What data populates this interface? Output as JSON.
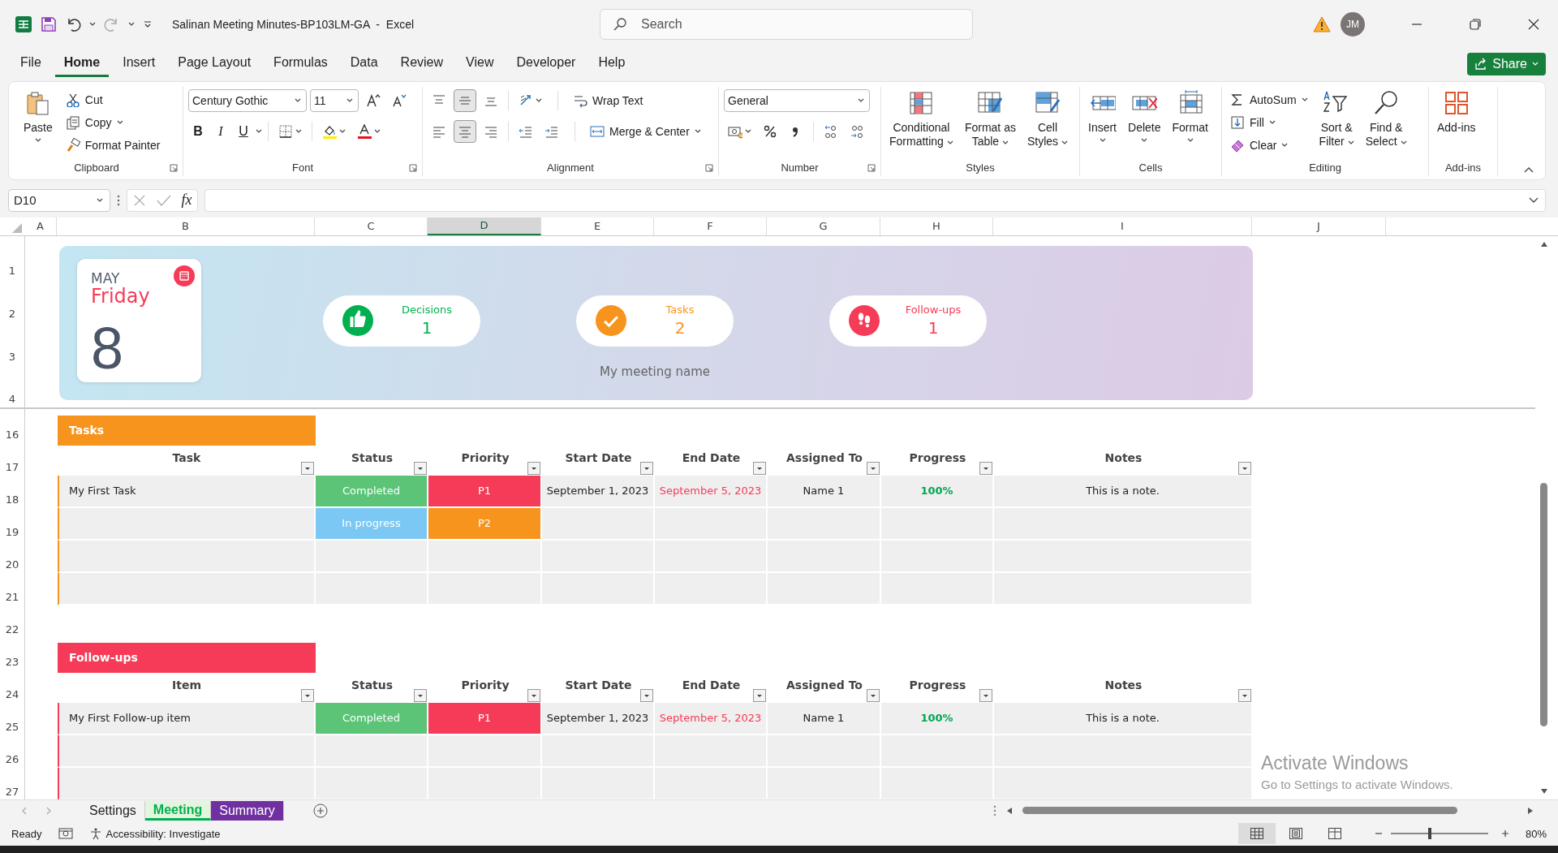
{
  "title_bar": {
    "document_title": "Salinan Meeting Minutes-BP103LM-GA  -  Excel",
    "search_placeholder": "Search",
    "user_initials": "JM"
  },
  "menu_tabs": [
    {
      "label": "File",
      "selected": false
    },
    {
      "label": "Home",
      "selected": true
    },
    {
      "label": "Insert",
      "selected": false
    },
    {
      "label": "Page Layout",
      "selected": false
    },
    {
      "label": "Formulas",
      "selected": false
    },
    {
      "label": "Data",
      "selected": false
    },
    {
      "label": "Review",
      "selected": false
    },
    {
      "label": "View",
      "selected": false
    },
    {
      "label": "Developer",
      "selected": false
    },
    {
      "label": "Help",
      "selected": false
    }
  ],
  "share_button": "Share",
  "ribbon": {
    "clipboard": {
      "label": "Clipboard",
      "paste": "Paste",
      "cut": "Cut",
      "copy": "Copy",
      "format_painter": "Format Painter"
    },
    "font": {
      "label": "Font",
      "font_name": "Century Gothic",
      "font_size": "11",
      "bold": "B",
      "italic": "I",
      "underline": "U"
    },
    "alignment": {
      "label": "Alignment",
      "wrap_text": "Wrap Text",
      "merge_center": "Merge & Center"
    },
    "number": {
      "label": "Number",
      "format": "General"
    },
    "styles": {
      "label": "Styles",
      "buttons": [
        {
          "kind": "conditional",
          "lines": [
            "Conditional",
            "Formatting"
          ]
        },
        {
          "kind": "table",
          "lines": [
            "Format as",
            "Table"
          ]
        },
        {
          "kind": "cellstyles",
          "lines": [
            "Cell",
            "Styles"
          ]
        }
      ]
    },
    "cells": {
      "label": "Cells",
      "buttons": [
        {
          "kind": "insert",
          "lines": [
            "Insert"
          ]
        },
        {
          "kind": "delete",
          "lines": [
            "Delete"
          ]
        },
        {
          "kind": "format",
          "lines": [
            "Format"
          ]
        }
      ]
    },
    "editing": {
      "label": "Editing",
      "autosum": "AutoSum",
      "fill": "Fill",
      "clear": "Clear",
      "buttons": [
        {
          "kind": "sort",
          "lines": [
            "Sort &",
            "Filter"
          ]
        },
        {
          "kind": "find",
          "lines": [
            "Find &",
            "Select"
          ]
        }
      ]
    },
    "addins": {
      "label": "Add-ins",
      "buttons": [
        {
          "kind": "addins",
          "lines": [
            "Add-ins"
          ]
        }
      ]
    }
  },
  "formula_bar": {
    "name_box": "D10",
    "function_button": "fx"
  },
  "column_headers": [
    {
      "label": "A",
      "selected": false
    },
    {
      "label": "B",
      "selected": false
    },
    {
      "label": "C",
      "selected": false
    },
    {
      "label": "D",
      "selected": true
    },
    {
      "label": "E",
      "selected": false
    },
    {
      "label": "F",
      "selected": false
    },
    {
      "label": "G",
      "selected": false
    },
    {
      "label": "H",
      "selected": false
    },
    {
      "label": "I",
      "selected": false
    },
    {
      "label": "J",
      "selected": false
    }
  ],
  "row_headers": [
    "1",
    "2",
    "3",
    "4",
    "16",
    "17",
    "18",
    "19",
    "20",
    "21",
    "22",
    "23",
    "24",
    "25",
    "26",
    "27"
  ],
  "dashboard": {
    "month": "MAY",
    "weekday": "Friday",
    "day": "8",
    "meeting_name": "My meeting name",
    "stats": [
      {
        "kind": "decisions",
        "label": "Decisions",
        "value": "1",
        "color": "#00b050"
      },
      {
        "kind": "tasks",
        "label": "Tasks",
        "value": "2",
        "color": "#f7941d"
      },
      {
        "kind": "followups",
        "label": "Follow-ups",
        "value": "1",
        "color": "#f53b57"
      }
    ]
  },
  "tables": [
    {
      "title": "Tasks",
      "color": "#f7941d",
      "columns": [
        "Task",
        "Status",
        "Priority",
        "Start Date",
        "End Date",
        "Assigned To",
        "Progress",
        "Notes"
      ],
      "rows": [
        {
          "item": "My First Task",
          "status": {
            "text": "Completed",
            "color": "#5bc477"
          },
          "priority": {
            "text": "P1",
            "color": "#f53b57"
          },
          "start_date": "September 1, 2023",
          "end_date": "September 5, 2023",
          "assigned_to": "Name 1",
          "progress": "100%",
          "notes": "This is a note."
        },
        {
          "status": {
            "text": "In progress",
            "color": "#7cc8f5"
          },
          "priority": {
            "text": "P2",
            "color": "#f7941d"
          }
        }
      ]
    },
    {
      "title": "Follow-ups",
      "color": "#f53b57",
      "columns": [
        "Item",
        "Status",
        "Priority",
        "Start Date",
        "End Date",
        "Assigned To",
        "Progress",
        "Notes"
      ],
      "rows": [
        {
          "item": "My First Follow-up item",
          "status": {
            "text": "Completed",
            "color": "#5bc477"
          },
          "priority": {
            "text": "P1",
            "color": "#f53b57"
          },
          "start_date": "September 1, 2023",
          "end_date": "September 5, 2023",
          "assigned_to": "Name 1",
          "progress": "100%",
          "notes": "This is a note."
        }
      ]
    }
  ],
  "sheet_tabs": [
    {
      "label": "Settings",
      "selected": false
    },
    {
      "label": "Meeting",
      "selected": true,
      "color": "#00b050"
    },
    {
      "label": "Summary",
      "selected": false,
      "color": "#7030a0"
    }
  ],
  "windows_notice": {
    "title": "Activate Windows",
    "message": "Go to Settings to activate Windows."
  },
  "status_bar": {
    "mode": "Ready",
    "accessibility": "Accessibility: Investigate",
    "zoom": {
      "label": "80%",
      "level": 0.4
    }
  }
}
